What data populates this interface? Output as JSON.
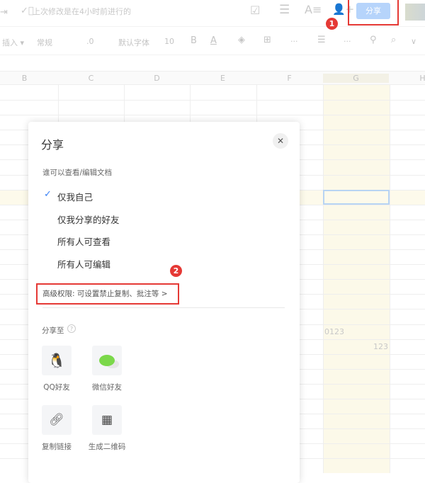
{
  "header": {
    "status": "上次修改是在4小时前进行的",
    "share_label": "分享",
    "annotation_1": "1"
  },
  "toolbar": {
    "insert": "插入",
    "format": "常规",
    "decimal": ".0",
    "font": "默认字体",
    "size": "10",
    "bold": "B",
    "color_a": "A",
    "more": "···"
  },
  "columns": [
    "B",
    "C",
    "D",
    "E",
    "F",
    "G",
    "H"
  ],
  "cells": {
    "g_text": "0123",
    "g_number": "123"
  },
  "dialog": {
    "title": "分享",
    "who_label": "谁可以查看/编辑文档",
    "options": [
      {
        "label": "仅我自己",
        "selected": true
      },
      {
        "label": "仅我分享的好友",
        "selected": false
      },
      {
        "label": "所有人可查看",
        "selected": false
      },
      {
        "label": "所有人可编辑",
        "selected": false
      }
    ],
    "advanced": "高级权限: 可设置禁止复制、批注等 >",
    "annotation_2": "2",
    "share_to": "分享至",
    "targets": [
      {
        "label": "QQ好友"
      },
      {
        "label": "微信好友"
      },
      {
        "label": "复制链接"
      },
      {
        "label": "生成二维码"
      }
    ]
  },
  "colors": {
    "accent": "#3b82f6",
    "annotation": "#e53935",
    "share_button": "#b6d4fb",
    "highlight": "#fcf9e9"
  }
}
